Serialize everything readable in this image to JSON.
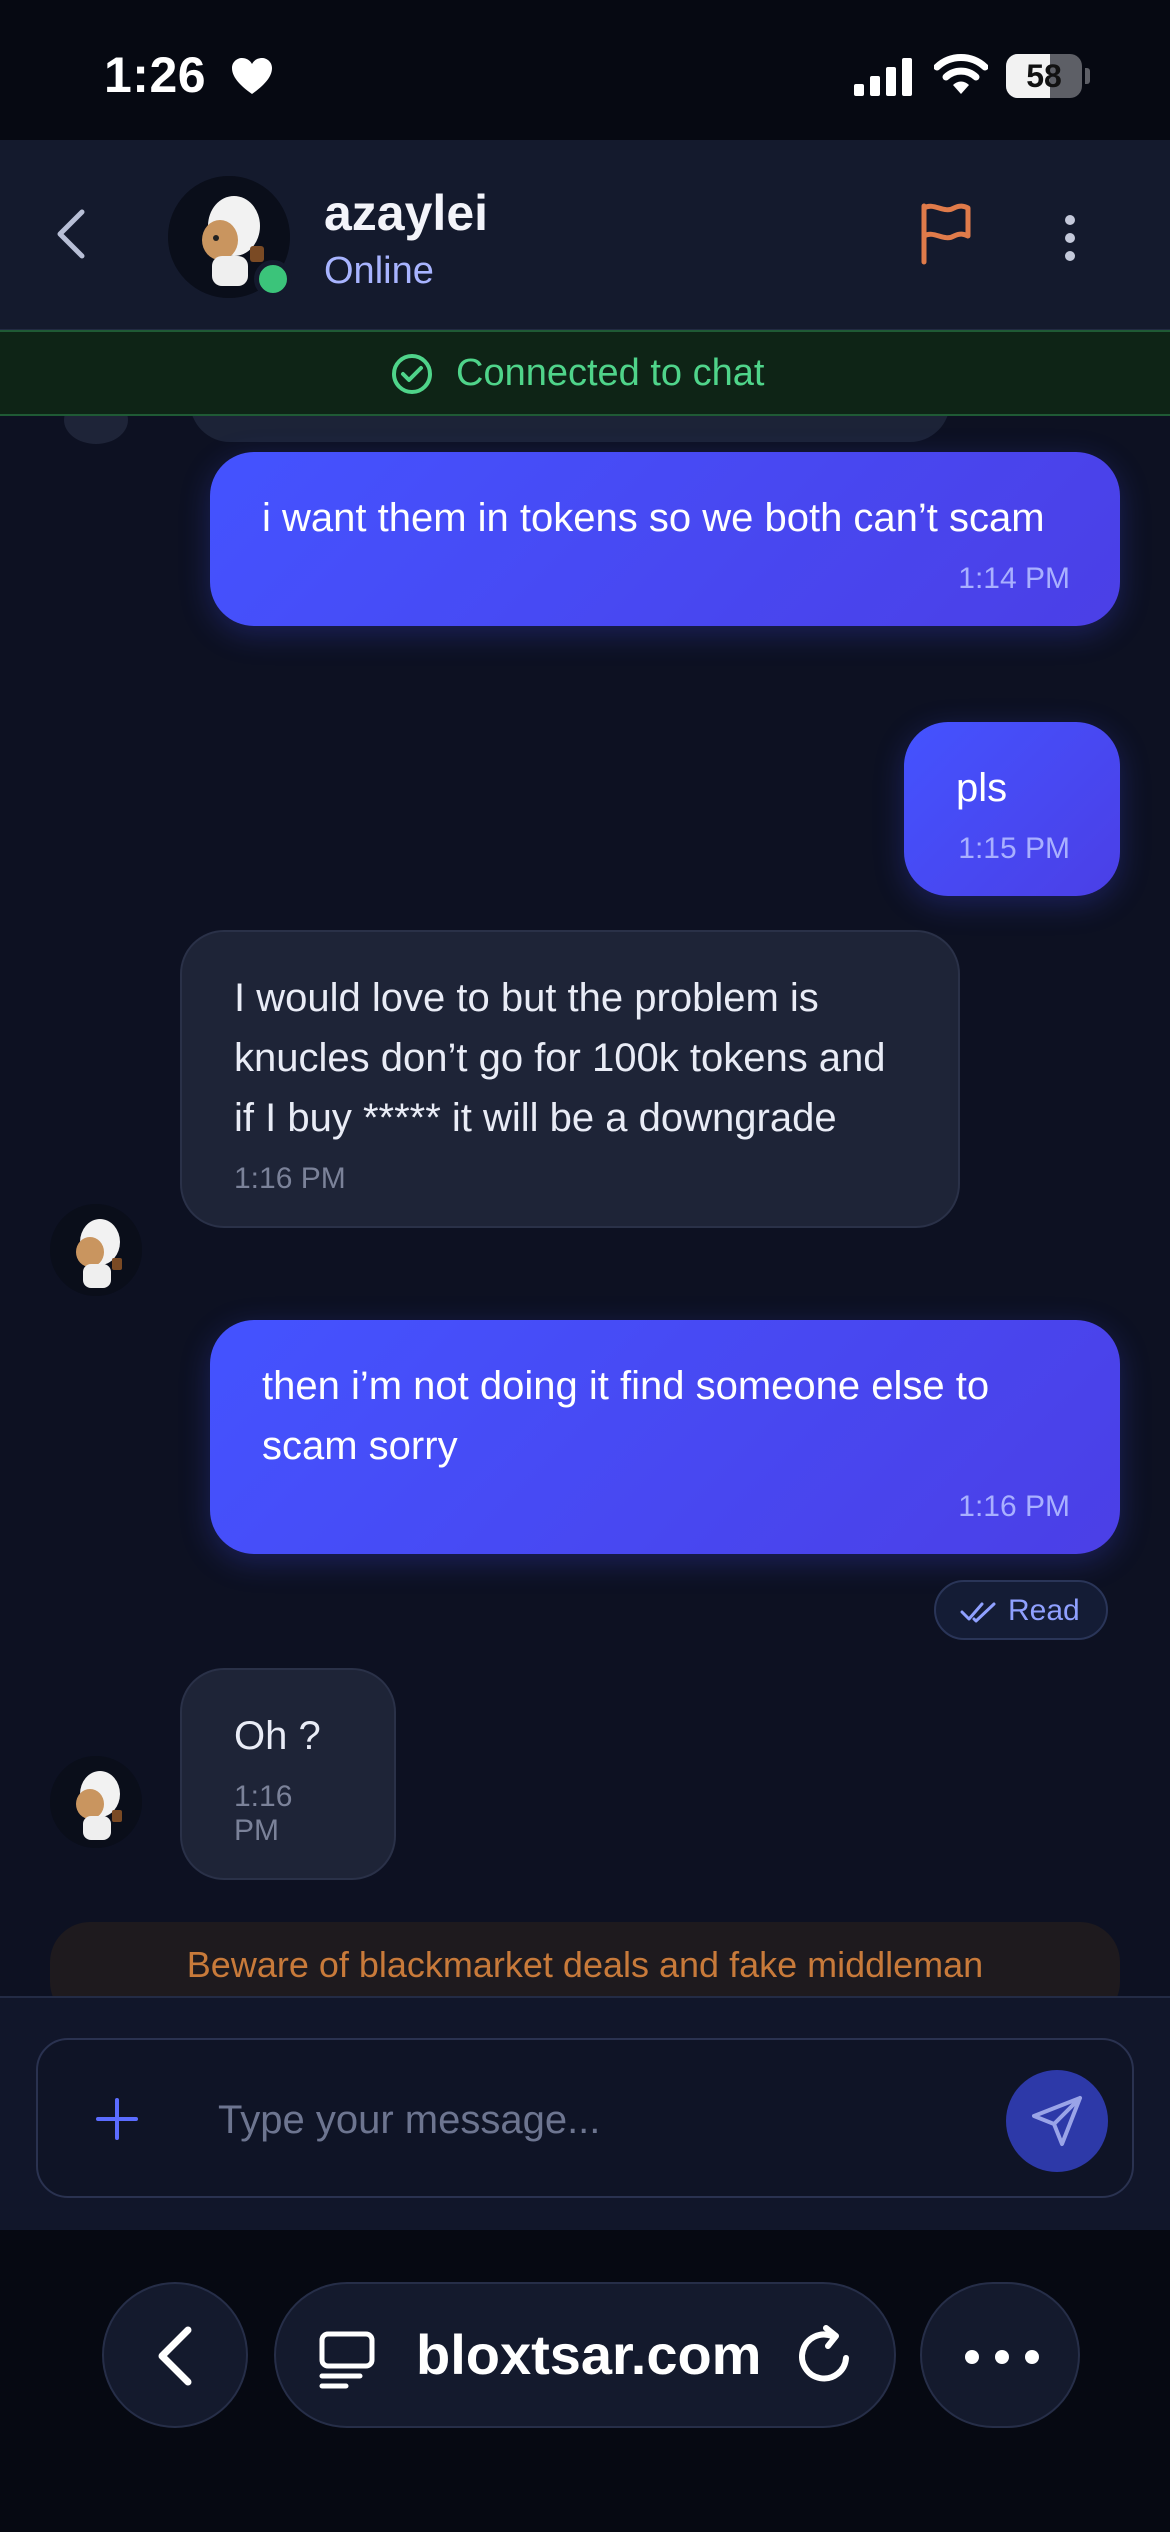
{
  "status_bar": {
    "time": "1:26",
    "battery_level": "58",
    "battery_fraction": 0.58,
    "icons": [
      "heart-icon",
      "signal-icon",
      "wifi-icon",
      "battery-icon"
    ]
  },
  "header": {
    "contact_name": "azaylei",
    "contact_status": "Online",
    "icons": [
      "back-chevron-icon",
      "flag-icon",
      "more-vertical-icon"
    ],
    "accent_color": "#a8b4ff",
    "flag_color": "#e07b4a"
  },
  "connection": {
    "label": "Connected to chat",
    "color": "#4fd48a"
  },
  "messages": [
    {
      "direction": "outgoing",
      "text": "i want them in tokens so we both can’t scam",
      "time": "1:14 PM"
    },
    {
      "direction": "outgoing",
      "text": "pls",
      "time": "1:15 PM"
    },
    {
      "direction": "incoming",
      "text": "I would love to but the problem is knucles don’t go for 100k tokens and if I buy ***** it will be a downgrade",
      "time": "1:16 PM"
    },
    {
      "direction": "outgoing",
      "text": "then i’m not doing it find someone else to scam sorry",
      "time": "1:16 PM"
    },
    {
      "direction": "incoming",
      "text": "Oh ?",
      "time": "1:16 PM"
    }
  ],
  "read_receipt": "Read",
  "warning": "Beware of blackmarket deals and fake middleman",
  "composer": {
    "placeholder": "Type your message...",
    "value": ""
  },
  "browser": {
    "url": "bloxtsar.com"
  },
  "colors": {
    "outgoing_bubble": "#4453ff",
    "incoming_bubble": "#1e2437",
    "background": "#0d1122"
  }
}
